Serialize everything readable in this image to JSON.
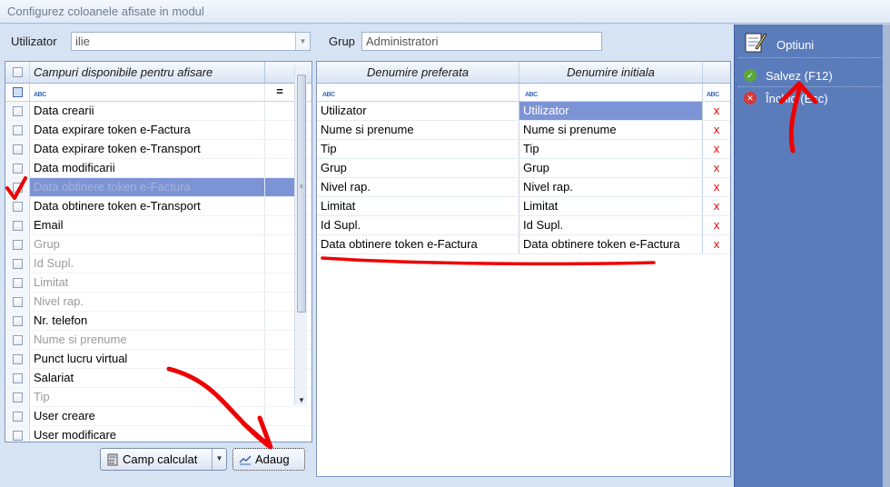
{
  "window": {
    "title": "Configurez coloanele afisate in modul"
  },
  "topbar": {
    "user_label": "Utilizator",
    "user_value": "ilie",
    "group_label": "Grup",
    "group_value": "Administratori"
  },
  "left_grid": {
    "header": "Campuri disponibile pentru afisare",
    "rows": [
      {
        "label": "Data crearii",
        "enabled": true
      },
      {
        "label": "Data expirare token e-Factura",
        "enabled": true
      },
      {
        "label": "Data expirare token e-Transport",
        "enabled": true
      },
      {
        "label": "Data modificarii",
        "enabled": true
      },
      {
        "label": "Data obtinere token e-Factura",
        "enabled": false,
        "selected": true
      },
      {
        "label": "Data obtinere token e-Transport",
        "enabled": true
      },
      {
        "label": "Email",
        "enabled": true
      },
      {
        "label": "Grup",
        "enabled": false
      },
      {
        "label": "Id Supl.",
        "enabled": false
      },
      {
        "label": "Limitat",
        "enabled": false
      },
      {
        "label": "Nivel rap.",
        "enabled": false
      },
      {
        "label": "Nr. telefon",
        "enabled": true
      },
      {
        "label": "Nume si prenume",
        "enabled": false
      },
      {
        "label": "Punct lucru virtual",
        "enabled": true
      },
      {
        "label": "Salariat",
        "enabled": true
      },
      {
        "label": "Tip",
        "enabled": false
      },
      {
        "label": "User creare",
        "enabled": true
      },
      {
        "label": "User modificare",
        "enabled": true
      }
    ]
  },
  "right_grid": {
    "header_preferred": "Denumire preferata",
    "header_initial": "Denumire initiala",
    "delete_glyph": "x",
    "rows": [
      {
        "preferred": "Utilizator",
        "initial": "Utilizator"
      },
      {
        "preferred": "Nume si prenume",
        "initial": "Nume si prenume"
      },
      {
        "preferred": "Tip",
        "initial": "Tip"
      },
      {
        "preferred": "Grup",
        "initial": "Grup"
      },
      {
        "preferred": "Nivel rap.",
        "initial": "Nivel rap."
      },
      {
        "preferred": "Limitat",
        "initial": "Limitat"
      },
      {
        "preferred": "Id Supl.",
        "initial": "Id Supl."
      },
      {
        "preferred": "Data obtinere token e-Factura",
        "initial": "Data obtinere token e-Factura"
      }
    ]
  },
  "buttons": {
    "calc_label": "Camp calculat",
    "add_label": "Adaug"
  },
  "options": {
    "header": "Optiuni",
    "save_label": "Salvez (F12)",
    "close_label": "Închid (Esc)"
  },
  "colors": {
    "selection": "#7c94d6",
    "panel": "#5b7cbb",
    "annotation": "#e00000"
  }
}
